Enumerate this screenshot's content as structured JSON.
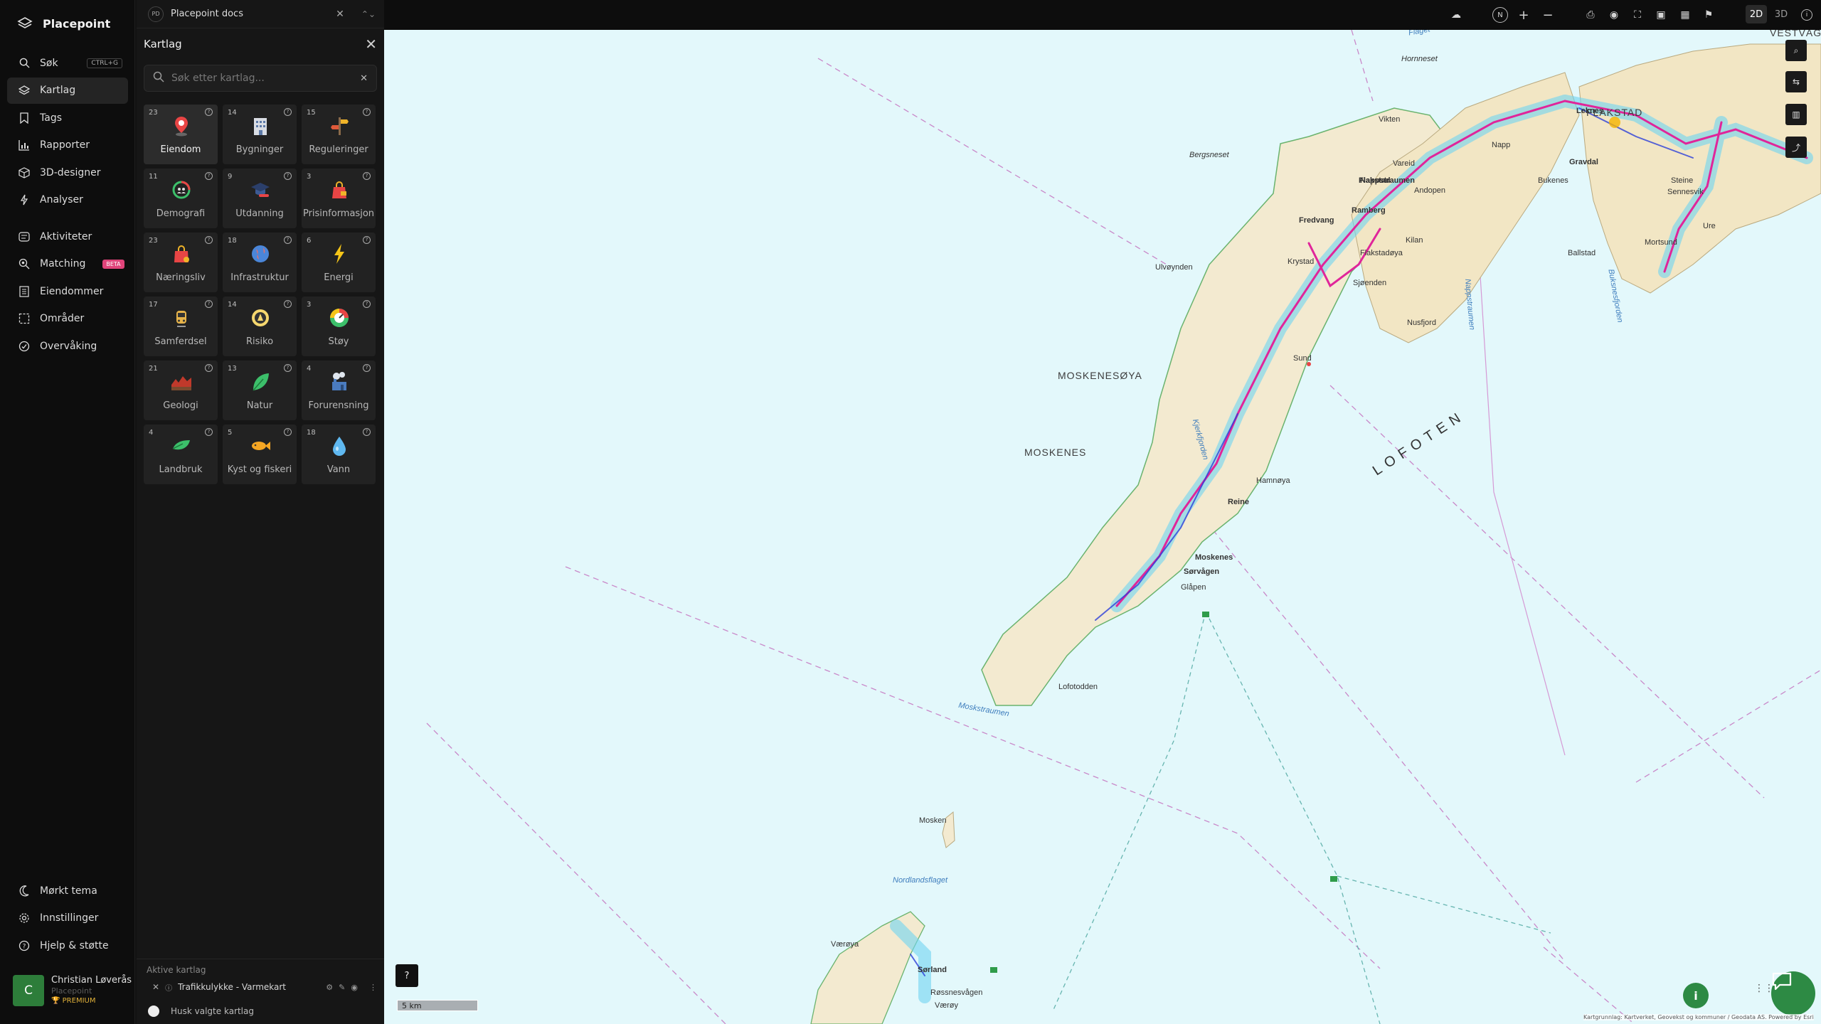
{
  "app": {
    "name": "Placepoint"
  },
  "nav": {
    "items": [
      {
        "label": "Søk",
        "icon": "search-icon",
        "shortcut": "CTRL+G"
      },
      {
        "label": "Kartlag",
        "icon": "layers-icon",
        "active": true
      },
      {
        "label": "Tags",
        "icon": "bookmark-icon"
      },
      {
        "label": "Rapporter",
        "icon": "bar-chart-icon"
      },
      {
        "label": "3D-designer",
        "icon": "cube-icon"
      },
      {
        "label": "Analyser",
        "icon": "bolt-icon"
      }
    ],
    "items2": [
      {
        "label": "Aktiviteter",
        "icon": "activity-icon"
      },
      {
        "label": "Matching",
        "icon": "match-search-icon",
        "badge": "BETA"
      },
      {
        "label": "Eiendommer",
        "icon": "building-icon"
      },
      {
        "label": "Områder",
        "icon": "area-icon"
      },
      {
        "label": "Overvåking",
        "icon": "monitor-icon"
      }
    ],
    "bottom": [
      {
        "label": "Mørkt tema",
        "icon": "moon-icon"
      },
      {
        "label": "Innstillinger",
        "icon": "gear-icon"
      },
      {
        "label": "Hjelp & støtte",
        "icon": "help-icon"
      }
    ],
    "user": {
      "initial": "C",
      "name": "Christian Løverås",
      "org": "Placepoint",
      "plan": "PREMIUM"
    }
  },
  "panel": {
    "doc_badge": "PD",
    "doc_title": "Placepoint docs",
    "title": "Kartlag",
    "search_placeholder": "Søk etter kartlag...",
    "tiles": [
      {
        "count": "23",
        "label": "Eiendom",
        "icon": "pin-icon"
      },
      {
        "count": "14",
        "label": "Bygninger",
        "icon": "building-icon"
      },
      {
        "count": "15",
        "label": "Reguleringer",
        "icon": "signpost-icon"
      },
      {
        "count": "11",
        "label": "Demografi",
        "icon": "demography-icon"
      },
      {
        "count": "9",
        "label": "Utdanning",
        "icon": "graduation-icon"
      },
      {
        "count": "3",
        "label": "Prisinformasjon",
        "icon": "price-bag-icon"
      },
      {
        "count": "23",
        "label": "Næringsliv",
        "icon": "shopping-bag-icon"
      },
      {
        "count": "18",
        "label": "Infrastruktur",
        "icon": "globe-icon"
      },
      {
        "count": "6",
        "label": "Energi",
        "icon": "lightning-icon"
      },
      {
        "count": "17",
        "label": "Samferdsel",
        "icon": "train-icon"
      },
      {
        "count": "14",
        "label": "Risiko",
        "icon": "risk-icon"
      },
      {
        "count": "3",
        "label": "Støy",
        "icon": "noise-gauge-icon"
      },
      {
        "count": "21",
        "label": "Geologi",
        "icon": "geology-icon"
      },
      {
        "count": "13",
        "label": "Natur",
        "icon": "leaf-icon"
      },
      {
        "count": "4",
        "label": "Forurensning",
        "icon": "factory-icon"
      },
      {
        "count": "4",
        "label": "Landbruk",
        "icon": "plant-icon"
      },
      {
        "count": "5",
        "label": "Kyst og fiskeri",
        "icon": "fish-icon"
      },
      {
        "count": "18",
        "label": "Vann",
        "icon": "water-drop-icon"
      }
    ],
    "active_title": "Aktive kartlag",
    "active_layer": "Trafikkulykke - Varmekart",
    "remember_label": "Husk valgte kartlag"
  },
  "toolbar": {
    "view_2d": "2D",
    "view_3d": "3D",
    "compass": "N"
  },
  "map": {
    "labels": {
      "vestvagoya": "VESTVÅGØYA",
      "flakstad_region": "FLAKSTAD",
      "moskenesoya": "MOSKENESØYA",
      "moskenes_region": "MOSKENES",
      "lofoten": "LOFOTEN",
      "flaget": "Flaget",
      "moskstraumen": "Moskstraumen",
      "nordlandsflaget": "Nordlandsflaget",
      "nappstraumen": "Nappstraumen",
      "buksnesfjorden": "Buksnesfjorden",
      "kjerkfjorden": "Kjerkfjorden",
      "hornneset": "Hornneset",
      "bergsneset": "Bergsneset",
      "vikten": "Vikten",
      "napp": "Napp",
      "leknes": "Leknes",
      "gravdal": "Gravdal",
      "bukenes": "Bukenes",
      "ballstad": "Ballstad",
      "mortsund": "Mortsund",
      "steine": "Steine",
      "sennesvik": "Sennesvik",
      "ure": "Ure",
      "flakstad": "Flakstad",
      "vareid": "Vareid",
      "andopen": "Andopen",
      "fredvang": "Fredvang",
      "ramberg": "Ramberg",
      "krystad": "Krystad",
      "flakstadoya": "Flakstadøya",
      "kilan": "Kilan",
      "sjoenden": "Sjøenden",
      "nusfjord": "Nusfjord",
      "ulvoynden": "Ulvøynden",
      "sund": "Sund",
      "hamnoya": "Hamnøya",
      "reine": "Reine",
      "moskenes": "Moskenes",
      "sorvagen": "Sørvågen",
      "glapen": "Glåpen",
      "lofotodden": "Lofotodden",
      "mosken": "Mosken",
      "vaeroya": "Værøya",
      "sorland": "Sørland",
      "rossnesvagen": "Røssnesvågen",
      "vaeroy": "Værøy"
    },
    "scale": "5 km",
    "attribution": "Kartgrunnlag: Kartverket, Geovekst og kommuner / Geodata AS. Powered by Esri"
  }
}
